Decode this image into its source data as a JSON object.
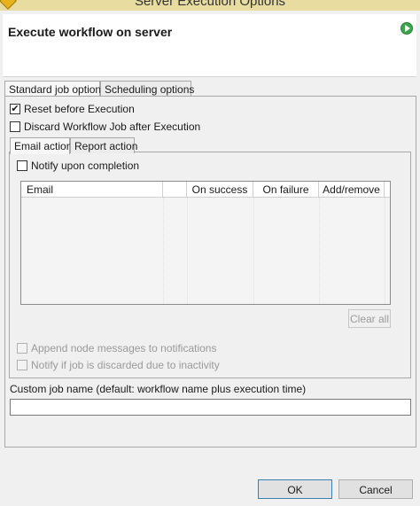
{
  "window": {
    "title": "Server Execution Options"
  },
  "header": {
    "title": "Execute workflow on server"
  },
  "tabs": [
    {
      "label": "Standard job options",
      "active": true
    },
    {
      "label": "Scheduling options",
      "active": false
    }
  ],
  "standard": {
    "reset_before_execution": {
      "label": "Reset before Execution",
      "checked": true
    },
    "discard_job": {
      "label": "Discard Workflow Job after Execution",
      "checked": false
    }
  },
  "subtabs": [
    {
      "label": "Email action",
      "active": true
    },
    {
      "label": "Report action",
      "active": false
    }
  ],
  "email": {
    "notify_label": "Notify upon completion",
    "notify_checked": false,
    "columns": [
      "Email",
      "",
      "On success",
      "On failure",
      "Add/remove"
    ],
    "rows": [],
    "clear_all_label": "Clear all"
  },
  "options": {
    "append_messages_label": "Append node messages to notifications",
    "notify_discarded_label": "Notify if job is discarded due to inactivity"
  },
  "custom_job_name": {
    "label": "Custom job name (default: workflow name plus execution time)",
    "value": ""
  },
  "buttons": {
    "ok": "OK",
    "cancel": "Cancel"
  }
}
